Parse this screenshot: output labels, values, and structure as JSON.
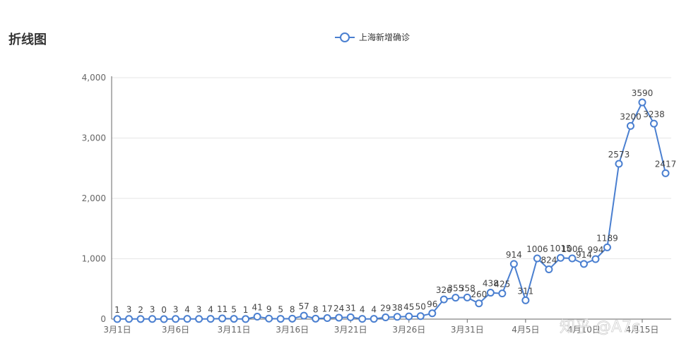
{
  "page": {
    "title": "折线图"
  },
  "watermark": "知乎 @A7c",
  "colors": {
    "series": "#4a7fd0",
    "grid": "#e6e6e6",
    "axis": "#666666"
  },
  "chart_data": {
    "type": "line",
    "legend_position": "top-center",
    "grid": true,
    "ylim": [
      0,
      4000
    ],
    "yticks": [
      0,
      1000,
      2000,
      3000,
      4000
    ],
    "ytick_labels": [
      "0",
      "1,000",
      "2,000",
      "3,000",
      "4,000"
    ],
    "xtick_indices": [
      0,
      5,
      10,
      15,
      20,
      25,
      30,
      35,
      40,
      45
    ],
    "xtick_labels": [
      "3月1日",
      "3月6日",
      "3月11日",
      "3月16日",
      "3月21日",
      "3月26日",
      "3月31日",
      "4月5日",
      "4月10日",
      "4月15日"
    ],
    "x": [
      "3月1日",
      "3月2日",
      "3月3日",
      "3月4日",
      "3月5日",
      "3月6日",
      "3月7日",
      "3月8日",
      "3月9日",
      "3月10日",
      "3月11日",
      "3月12日",
      "3月13日",
      "3月14日",
      "3月15日",
      "3月16日",
      "3月17日",
      "3月18日",
      "3月19日",
      "3月20日",
      "3月21日",
      "3月22日",
      "3月23日",
      "3月24日",
      "3月25日",
      "3月26日",
      "3月27日",
      "3月28日",
      "3月29日",
      "3月30日",
      "3月31日",
      "4月1日",
      "4月2日",
      "4月3日",
      "4月4日",
      "4月5日",
      "4月6日",
      "4月7日",
      "4月8日",
      "4月9日",
      "4月10日",
      "4月11日",
      "4月12日",
      "4月13日",
      "4月14日",
      "4月15日",
      "4月16日",
      "4月17日"
    ],
    "series": [
      {
        "name": "上海新增确诊",
        "values": [
          1,
          3,
          2,
          3,
          0,
          3,
          4,
          3,
          4,
          11,
          5,
          1,
          41,
          9,
          5,
          8,
          57,
          8,
          17,
          24,
          31,
          4,
          4,
          29,
          38,
          45,
          50,
          96,
          326,
          355,
          358,
          260,
          438,
          425,
          914,
          311,
          1006,
          824,
          1015,
          1006,
          914,
          994,
          1189,
          2573,
          3200,
          3590,
          3238,
          2417
        ]
      }
    ]
  }
}
